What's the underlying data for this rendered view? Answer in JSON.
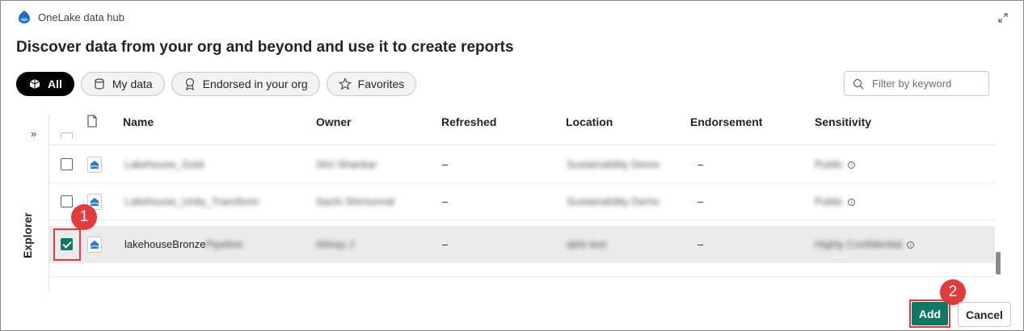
{
  "window": {
    "title": "OneLake data hub"
  },
  "heading": "Discover data from your org and beyond and use it to create reports",
  "filters": {
    "pills": [
      {
        "label": "All",
        "icon": "all-icon",
        "active": true
      },
      {
        "label": "My data",
        "icon": "database-icon",
        "active": false
      },
      {
        "label": "Endorsed in your org",
        "icon": "ribbon-icon",
        "active": false
      },
      {
        "label": "Favorites",
        "icon": "star-icon",
        "active": false
      }
    ],
    "search_placeholder": "Filter by keyword"
  },
  "explorer": {
    "label": "Explorer",
    "toggle_glyph": "»"
  },
  "table": {
    "columns": [
      "Name",
      "Owner",
      "Refreshed",
      "Location",
      "Endorsement",
      "Sensitivity"
    ],
    "rows": [
      {
        "name": "Lakehouse_Gold",
        "owner": "Shri Shankar",
        "refreshed": "–",
        "location": "Sustainability Demo",
        "endorsement": "–",
        "sensitivity": "Public",
        "checked": false
      },
      {
        "name": "Lakehouse_Unity_Transform",
        "owner": "Sachi Shirisomal",
        "refreshed": "–",
        "location": "Sustainability Demo",
        "endorsement": "–",
        "sensitivity": "Public",
        "checked": false
      },
      {
        "name_prefix": "lakehouseBronze",
        "name_suffix": "Pipeline",
        "owner": "Abhay J",
        "refreshed": "–",
        "location": "abhi test",
        "endorsement": "–",
        "sensitivity": "Highly Confidential",
        "checked": true
      }
    ]
  },
  "annotations": {
    "step1": "1",
    "step2": "2"
  },
  "footer": {
    "add_label": "Add",
    "cancel_label": "Cancel"
  },
  "colors": {
    "accent": "#117865",
    "annotation": "#e23b3b",
    "active_pill": "#000000"
  }
}
